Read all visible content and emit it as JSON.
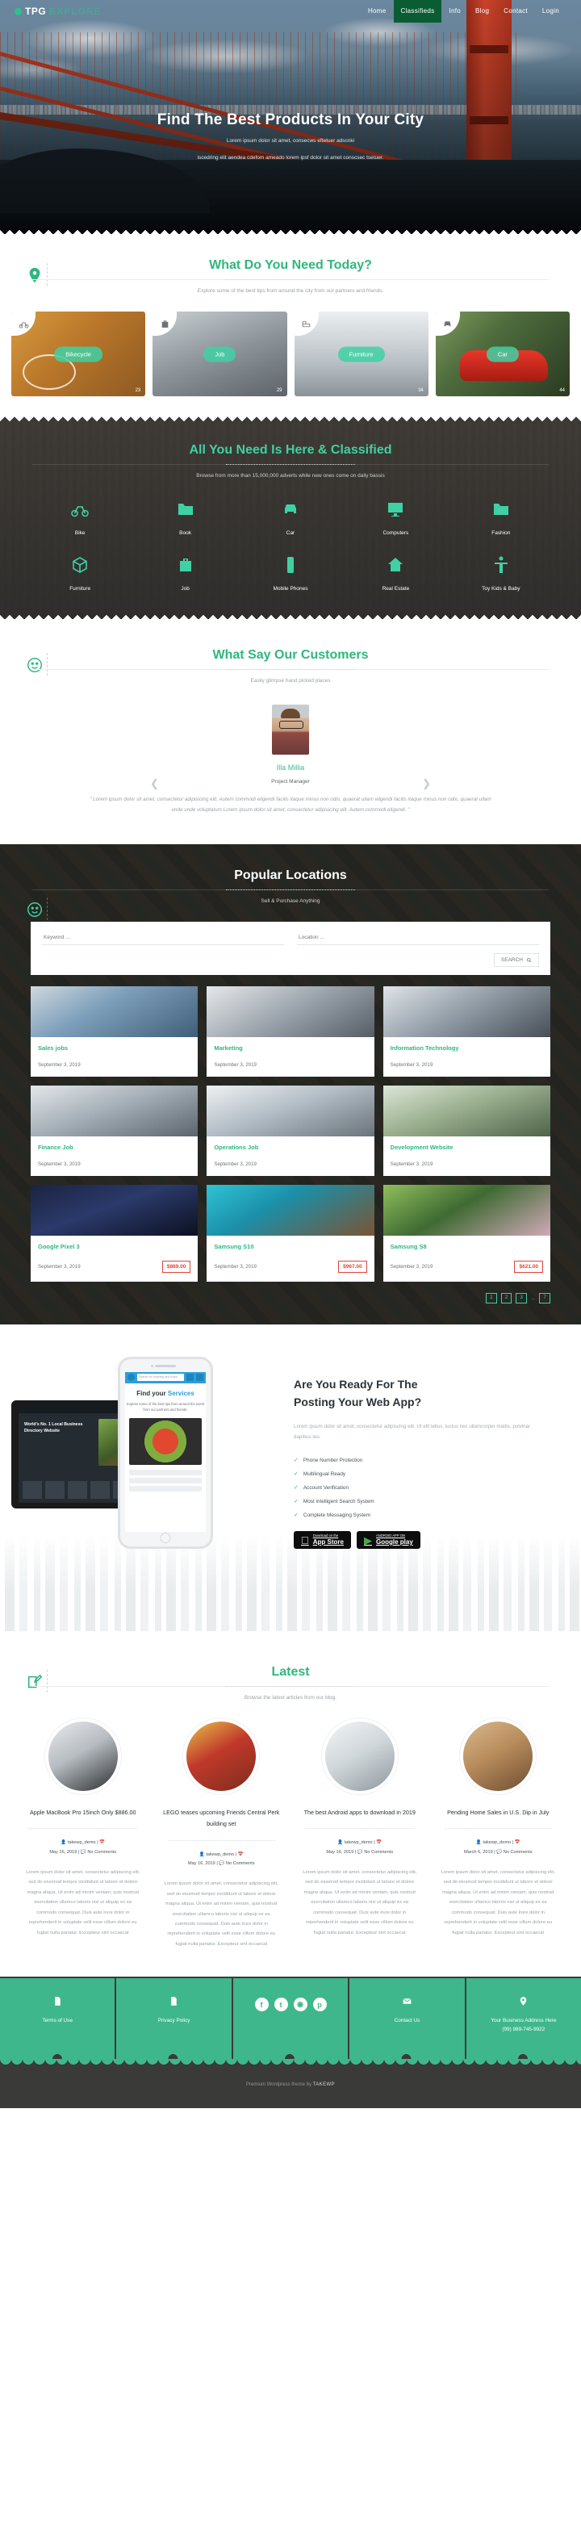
{
  "header": {
    "logo_mark": "dot-icon",
    "logo_primary": "TPG",
    "logo_secondary": "EXPLORE",
    "nav": [
      {
        "label": "Home",
        "active": false
      },
      {
        "label": "Classifieds",
        "active": true
      },
      {
        "label": "Info",
        "active": false
      },
      {
        "label": "Blog",
        "active": false
      },
      {
        "label": "Contact",
        "active": false
      },
      {
        "label": "Login",
        "active": false
      }
    ]
  },
  "hero": {
    "title": "Find The Best Products In Your City",
    "sub_line1": "Lorem ipsum dolor sit amet, consecws eftetuer adscnki",
    "sub_line2": "iscedring elit aendea cdefom ameado lorem ipsf dolor sit amet conscsec tsetuer."
  },
  "needs": {
    "icon": "map-pin-icon",
    "title": "What Do You Need Today?",
    "subtitle": "Explore some of the best tips from around the city from our partners and friends.",
    "cards": [
      {
        "label": "Bikecycle",
        "count": "23",
        "icon": "bicycle-icon"
      },
      {
        "label": "Job",
        "count": "29",
        "icon": "briefcase-icon"
      },
      {
        "label": "Furniture",
        "count": "34",
        "icon": "sofa-icon"
      },
      {
        "label": "Car",
        "count": "44",
        "icon": "car-icon"
      }
    ]
  },
  "classified": {
    "title": "All You Need Is Here & Classified",
    "subtitle": "Browse from more than 15,000,000 adverts while new ones come on daily bassis",
    "items": [
      {
        "label": "Bike",
        "icon": "bicycle-icon"
      },
      {
        "label": "Book",
        "icon": "folder-icon"
      },
      {
        "label": "Car",
        "icon": "car-icon"
      },
      {
        "label": "Computers",
        "icon": "monitor-icon"
      },
      {
        "label": "Fashion",
        "icon": "folder-icon"
      },
      {
        "label": "Furniture",
        "icon": "box-icon"
      },
      {
        "label": "Job",
        "icon": "briefcase-icon"
      },
      {
        "label": "Mobile Phones",
        "icon": "smartphone-icon"
      },
      {
        "label": "Real Estate",
        "icon": "home-icon"
      },
      {
        "label": "Toy Kids & Baby",
        "icon": "child-icon"
      }
    ]
  },
  "testimonials": {
    "icon": "smiley-icon",
    "title": "What Say Our Customers",
    "subtitle": "Easily glimpse hand picked places",
    "name": "Illa Millia",
    "role": "Project Manager",
    "quote": "\" Lorem ipsum dolor sit amet, consectetur adipisicing elit. Autem commodi eligendi facilis itaque minus non odio, quaerat ullam eligendi facilis itaque minus non odio, quaerat ullam unde unde voluptatum Lorem ipsum dolor sit amet, consectetur adipisicing elit. Autem commodi eligendi. \"",
    "prev_icon": "chevron-left-icon",
    "next_icon": "chevron-right-icon"
  },
  "locations": {
    "icon": "smiley-icon",
    "title": "Popular Locations",
    "subtitle": "Sell & Purchase Anything",
    "search": {
      "keyword_placeholder": "Keyword ...",
      "location_placeholder": "Location ...",
      "button_label": "SEARCH",
      "button_icon": "search-icon"
    },
    "listings": [
      {
        "title": "Sales jobs",
        "date": "September 3, 2019",
        "price": ""
      },
      {
        "title": "Marketing",
        "date": "September 3, 2019",
        "price": ""
      },
      {
        "title": "Information Technology",
        "date": "September 3, 2019",
        "price": ""
      },
      {
        "title": "Finance Job",
        "date": "September 3, 2019",
        "price": ""
      },
      {
        "title": "Operations Job",
        "date": "September 3, 2019",
        "price": ""
      },
      {
        "title": "Development Website",
        "date": "September 3, 2019",
        "price": ""
      },
      {
        "title": "Google Pixel 3",
        "date": "September 3, 2019",
        "price": "$889.00"
      },
      {
        "title": "Samsung S10",
        "date": "September 3, 2019",
        "price": "$967.00"
      },
      {
        "title": "Samsung S8",
        "date": "September 3, 2019",
        "price": "$621.00"
      }
    ],
    "pagination": [
      "1",
      "2",
      "3",
      "...",
      "7"
    ]
  },
  "promo": {
    "phone_screen": {
      "search_placeholder": "Search for Anything and Anyw",
      "title_part1": "Find your ",
      "title_part2": "Services",
      "subtitle": "Explore some of the best tips from around the world from our partners and friends."
    },
    "title_line1": "Are You Ready For The",
    "title_line2": "Posting Your Web App?",
    "paragraph": "Lorem ipsum dolor sit amet, consectetur adipiscing elit. Ut elit tellus, luctus nec ullamcorper mattis, pulvinar dapibus leo.",
    "features": [
      "Phone Number Protection",
      "Multilingual Ready",
      "Account Verification",
      "Most intelligent Search System",
      "Complete Messaging System"
    ],
    "badges": [
      {
        "icon": "apple-icon",
        "small": "Download on the",
        "big": "App Store"
      },
      {
        "icon": "play-icon",
        "small": "ANDROID APP ON",
        "big": "Google play"
      }
    ]
  },
  "latest": {
    "icon": "edit-icon",
    "title": "Latest",
    "subtitle": "Browse the latest articles from our blog.",
    "posts": [
      {
        "title": "Apple MacBook Pro 15inch Only $886.00",
        "author": "takewp_demo",
        "date": "May 16, 2019",
        "comments": "No Comments",
        "excerpt": "Lorem ipsum dolor sit amet, consectetur adipiscing elit, sed do eiusmod tempor incididunt ut labore et dolore magna aliqua. Ut enim ad minim veniam, quis nostrud exercitation ullamco laboris nisi ut aliquip ex ea commodo consequat. Duis aute irure dolor in reprehenderit in voluptate velit esse cillum dolore eu fugiat nulla pariatur. Excepteur sint occaecat"
      },
      {
        "title": "LEGO teases upcoming Friends Central Perk building set",
        "author": "takewp_demo",
        "date": "May 16, 2019",
        "comments": "No Comments",
        "excerpt": "Lorem ipsum dolor sit amet, consectetur adipiscing elit, sed do eiusmod tempor incididunt ut labore et dolore magna aliqua. Ut enim ad minim veniam, quis nostrud exercitation ullamco laboris nisi ut aliquip ex ea commodo consequat. Duis aute irure dolor in reprehenderit in voluptate velit esse cillum dolore eu fugiat nulla pariatur. Excepteur sint occaecat"
      },
      {
        "title": "The best Android apps to download in 2019",
        "author": "takewp_demo",
        "date": "May 16, 2019",
        "comments": "No Comments",
        "excerpt": "Lorem ipsum dolor sit amet, consectetur adipiscing elit, sed do eiusmod tempor incididunt ut labore et dolore magna aliqua. Ut enim ad minim veniam, quis nostrud exercitation ullamco laboris nisi ut aliquip ex ea commodo consequat. Duis aute irure dolor in reprehenderit in voluptate velit esse cillum dolore eu fugiat nulla pariatur. Excepteur sint occaecat"
      },
      {
        "title": "Pending Home Sales in U.S. Dip in July",
        "author": "takewp_demo",
        "date": "March 6, 2019",
        "comments": "No Comments",
        "excerpt": "Lorem ipsum dolor sit amet, consectetur adipiscing elit, sed do eiusmod tempor incididunt ut labore et dolore magna aliqua. Ut enim ad minim veniam, quis nostrud exercitation ullamco laboris nisi ut aliquip ex ea commodo consequat. Duis aute irure dolor in reprehenderit in voluptate velit esse cillum dolore eu fugiat nulla pariatur. Excepteur sint occaecat"
      }
    ]
  },
  "footer": {
    "columns": [
      {
        "icon": "document-icon",
        "label": "Terms of Use"
      },
      {
        "icon": "document-icon",
        "label": "Privacy Policy"
      },
      {
        "icon": "social-icons",
        "label": ""
      },
      {
        "icon": "envelope-icon",
        "label": "Contact Us"
      },
      {
        "icon": "map-pin-icon",
        "label": "Your Business Address Here\n(99) 989-745-9922"
      }
    ],
    "address_line1": "Your Business Address Here",
    "address_line2": "(99) 989-745-9922",
    "socials": [
      {
        "name": "facebook-icon",
        "glyph": "f"
      },
      {
        "name": "twitter-icon",
        "glyph": "t"
      },
      {
        "name": "instagram-icon",
        "glyph": "◉"
      },
      {
        "name": "pinterest-icon",
        "glyph": "p"
      }
    ],
    "copyright_prefix": "Premium Wordpress theme by ",
    "copyright_brand": "TAKEWP"
  },
  "colors": {
    "accent_green": "#2fb67f",
    "accent_teal": "#3fd1a4",
    "nav_active": "#0a5c33",
    "price_red": "#e0453a",
    "dark_bg": "#3a3a38"
  }
}
